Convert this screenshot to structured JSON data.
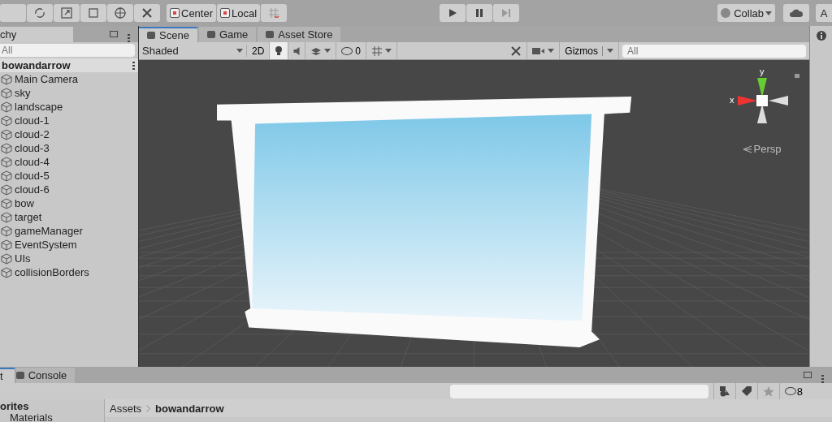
{
  "toolbar": {
    "pivot": [
      "Center",
      "Local"
    ],
    "collab": "Collab",
    "account": "A"
  },
  "hierarchy": {
    "tab": "chy",
    "search": {
      "placeholder": "All"
    },
    "scene": "bowandarrow",
    "items": [
      "Main Camera",
      "sky",
      "landscape",
      "cloud-1",
      "cloud-2",
      "cloud-3",
      "cloud-4",
      "cloud-5",
      "cloud-6",
      "bow",
      "target",
      "gameManager",
      "EventSystem",
      "UIs",
      "collisionBorders"
    ]
  },
  "scene_view": {
    "tabs": [
      {
        "label": "Scene",
        "selected": true
      },
      {
        "label": "Game",
        "selected": false
      },
      {
        "label": "Asset Store",
        "selected": false
      }
    ],
    "shading": "Shaded",
    "mode_2d": "2D",
    "lighting_on": true,
    "audio_on": false,
    "effects_on": false,
    "grid_on": false,
    "hidden_count": "0",
    "gizmos": "Gizmos",
    "search": {
      "placeholder": "All"
    },
    "axis_y": "y",
    "axis_x": "x",
    "projection": "Persp"
  },
  "bottom": {
    "tabs": [
      {
        "label": "t",
        "selected": true
      },
      {
        "label": "Console",
        "selected": false
      }
    ],
    "favorites": "orites",
    "favorite_item": "Materials",
    "breadcrumb": [
      "Assets",
      "bowandarrow"
    ],
    "hidden_count": "8"
  }
}
